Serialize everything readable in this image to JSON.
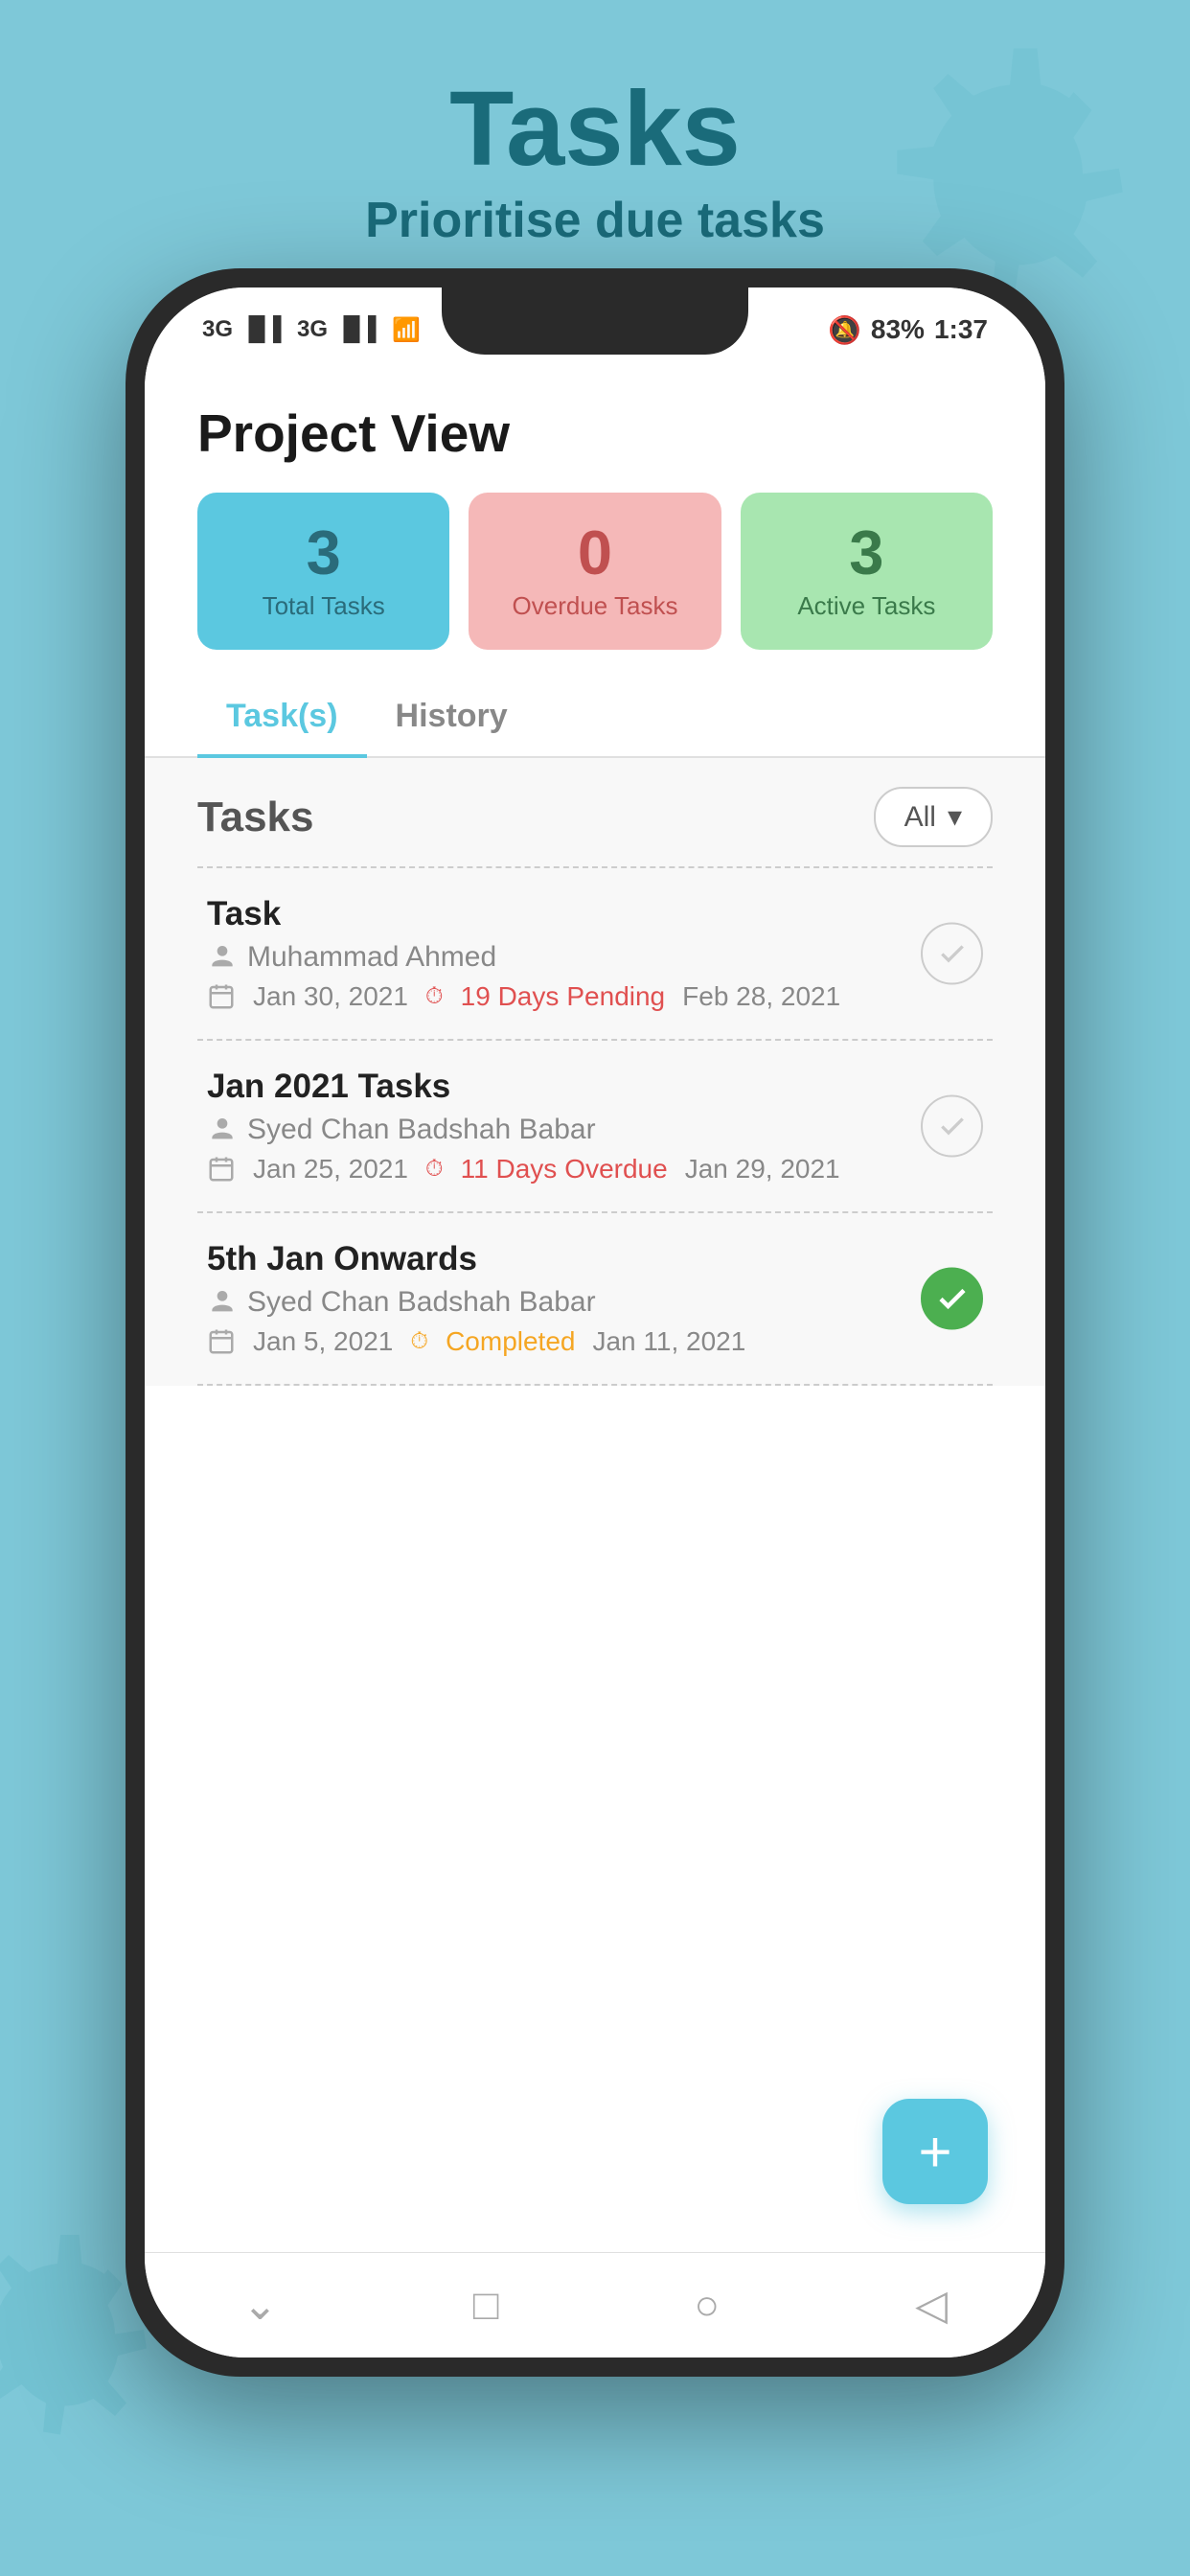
{
  "page": {
    "title": "Tasks",
    "subtitle": "Prioritise due tasks",
    "background_color": "#7ec8d8"
  },
  "status_bar": {
    "left": "3G  3G  WiFi",
    "time": "1:37",
    "battery": "83"
  },
  "project_view": {
    "title": "Project View",
    "stats": [
      {
        "number": "3",
        "label": "Total Tasks",
        "color": "blue"
      },
      {
        "number": "0",
        "label": "Overdue Tasks",
        "color": "pink"
      },
      {
        "number": "3",
        "label": "Active Tasks",
        "color": "green"
      }
    ]
  },
  "tabs": [
    {
      "label": "Task(s)",
      "active": true
    },
    {
      "label": "History",
      "active": false
    }
  ],
  "tasks_section": {
    "title": "Tasks",
    "filter_label": "All",
    "tasks": [
      {
        "name": "Task",
        "assignee": "Muhammad Ahmed",
        "start_date": "Jan 30, 2021",
        "duration": "19 Days",
        "status": "Pending",
        "end_date": "Feb 28, 2021",
        "completed": false
      },
      {
        "name": "Jan 2021 Tasks",
        "assignee": "Syed Chan Badshah Babar",
        "start_date": "Jan 25, 2021",
        "duration": "11 Days",
        "status": "Overdue",
        "end_date": "Jan 29, 2021",
        "completed": false
      },
      {
        "name": "5th Jan Onwards",
        "assignee": "Syed Chan Badshah Babar",
        "start_date": "Jan 5, 2021",
        "duration": "",
        "status": "Completed",
        "end_date": "Jan 11, 2021",
        "completed": true
      }
    ]
  },
  "nav": {
    "items": [
      {
        "icon": "chevron-down",
        "label": "down"
      },
      {
        "icon": "square",
        "label": "square"
      },
      {
        "icon": "circle",
        "label": "circle"
      },
      {
        "icon": "triangle-left",
        "label": "back"
      }
    ]
  },
  "fab": {
    "label": "+"
  }
}
